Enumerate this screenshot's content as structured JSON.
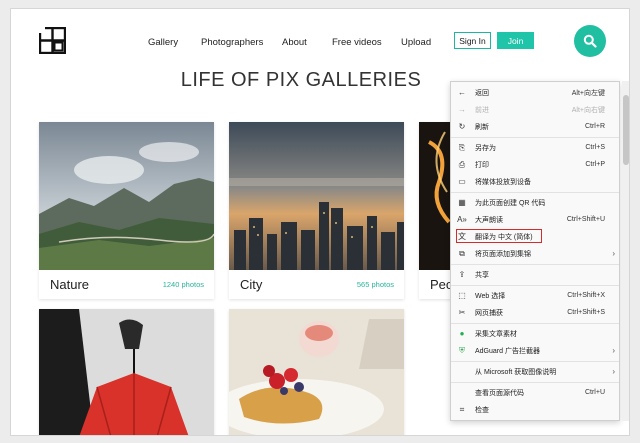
{
  "nav": {
    "items": [
      "Gallery",
      "Photographers",
      "About",
      "Free videos",
      "Upload"
    ],
    "signin_label": "Sign In",
    "join_label": "Join"
  },
  "page": {
    "title": "LIFE OF PIX GALLERIES"
  },
  "cards": [
    {
      "name": "Nature",
      "count": "1240 photos"
    },
    {
      "name": "City",
      "count": "565 photos"
    },
    {
      "name": "Peo",
      "count": ""
    }
  ],
  "menu": {
    "items": [
      {
        "label": "返回",
        "shortcut": "Alt+向左键",
        "icon": "back-arrow-icon",
        "disabled": false
      },
      {
        "label": "前进",
        "shortcut": "Alt+向右键",
        "icon": "forward-arrow-icon",
        "disabled": true
      },
      {
        "label": "刷新",
        "shortcut": "Ctrl+R",
        "icon": "refresh-icon",
        "disabled": false
      },
      {
        "label": "另存为",
        "shortcut": "Ctrl+S",
        "icon": "save-icon",
        "disabled": false
      },
      {
        "label": "打印",
        "shortcut": "Ctrl+P",
        "icon": "print-icon",
        "disabled": false
      },
      {
        "label": "将媒体投放到设备",
        "shortcut": "",
        "icon": "cast-icon",
        "disabled": false
      },
      {
        "label": "为此页面创建 QR 代码",
        "shortcut": "",
        "icon": "qr-code-icon",
        "disabled": false
      },
      {
        "label": "大声朗读",
        "shortcut": "Ctrl+Shift+U",
        "icon": "read-aloud-icon",
        "disabled": false
      },
      {
        "label": "翻译为 中文 (简体)",
        "shortcut": "",
        "icon": "translate-icon",
        "disabled": false
      },
      {
        "label": "将页面添加到集锦",
        "shortcut": "",
        "icon": "collections-icon",
        "disabled": false
      },
      {
        "label": "共享",
        "shortcut": "",
        "icon": "share-icon",
        "disabled": false
      },
      {
        "label": "Web 选择",
        "shortcut": "Ctrl+Shift+X",
        "icon": "web-select-icon",
        "disabled": false
      },
      {
        "label": "网页捕获",
        "shortcut": "Ctrl+Shift+S",
        "icon": "web-capture-icon",
        "disabled": false
      },
      {
        "label": "采集文章素材",
        "shortcut": "",
        "icon": "collect-icon",
        "disabled": false
      },
      {
        "label": "AdGuard 广告拦截器",
        "shortcut": "",
        "icon": "adguard-shield-icon",
        "disabled": false
      },
      {
        "label": "从 Microsoft 获取图像说明",
        "shortcut": "",
        "icon": "image-desc-icon",
        "disabled": false
      },
      {
        "label": "查看页面源代码",
        "shortcut": "Ctrl+U",
        "icon": "source-icon",
        "disabled": false
      },
      {
        "label": "检查",
        "shortcut": "",
        "icon": "inspect-icon",
        "disabled": false
      }
    ]
  },
  "colors": {
    "accent": "#21bfa1",
    "highlight": "#d32c2c"
  }
}
